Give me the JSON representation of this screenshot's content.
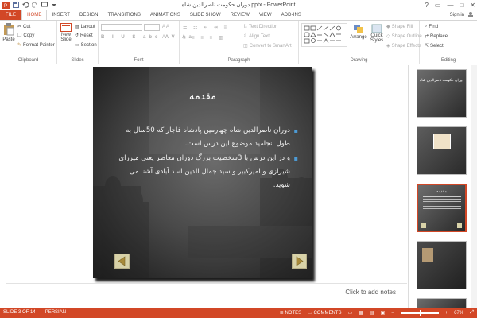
{
  "window": {
    "title": "دوران حکومت ناصرالدین شاه.pptx - PowerPoint",
    "controls": [
      "?",
      "▭",
      "—",
      "□",
      "✕"
    ]
  },
  "tabs": [
    "FILE",
    "HOME",
    "INSERT",
    "DESIGN",
    "TRANSITIONS",
    "ANIMATIONS",
    "SLIDE SHOW",
    "REVIEW",
    "VIEW",
    "ADD-INS"
  ],
  "active_tab": "HOME",
  "account": {
    "sign_in": "Sign in"
  },
  "ribbon": {
    "clipboard": {
      "label": "Clipboard",
      "paste": "Paste",
      "cut": "Cut",
      "copy": "Copy",
      "format_painter": "Format Painter"
    },
    "slides": {
      "label": "Slides",
      "new_slide_line1": "New",
      "new_slide_line2": "Slide",
      "layout": "Layout",
      "reset": "Reset",
      "section": "Section"
    },
    "font": {
      "label": "Font"
    },
    "paragraph": {
      "label": "Paragraph",
      "text_direction": "Text Direction",
      "align_text": "Align Text",
      "convert_smartart": "Convert to SmartArt"
    },
    "drawing": {
      "label": "Drawing",
      "arrange": "Arrange",
      "quick_styles_1": "Quick",
      "quick_styles_2": "Styles",
      "shape_fill": "Shape Fill",
      "shape_outline": "Shape Outline",
      "shape_effects": "Shape Effects"
    },
    "editing": {
      "label": "Editing",
      "find": "Find",
      "replace": "Replace",
      "select": "Select"
    }
  },
  "slide": {
    "title": "مقدمه",
    "bullets": [
      "دوران ناصرالدین شاه چهارمین پادشاه قاجار که 50سال به طول انجامید موضوع این درس است.",
      "و در این درس با 3شخصیت بزرگ دوران معاصر یعنی میرزای شیرازی و امیرکبیر و سید جمال الدین اسد آبادی آشنا می شوید."
    ]
  },
  "thumbnails": [
    {
      "num": "1",
      "caption": "دوران حکومت ناصرالدین شاه"
    },
    {
      "num": "2",
      "caption": ""
    },
    {
      "num": "3",
      "caption": "مقدمه"
    },
    {
      "num": "4",
      "caption": ""
    },
    {
      "num": "5",
      "caption": ""
    }
  ],
  "notes": {
    "placeholder": "Click to add notes"
  },
  "status": {
    "slide_of": "SLIDE 3 OF 14",
    "language": "PERSIAN",
    "notes": "NOTES",
    "comments": "COMMENTS",
    "zoom": "67%"
  },
  "colors": {
    "accent": "#d24726",
    "bullet": "#4d9bd6",
    "nav_button": "#d8d2a8"
  }
}
